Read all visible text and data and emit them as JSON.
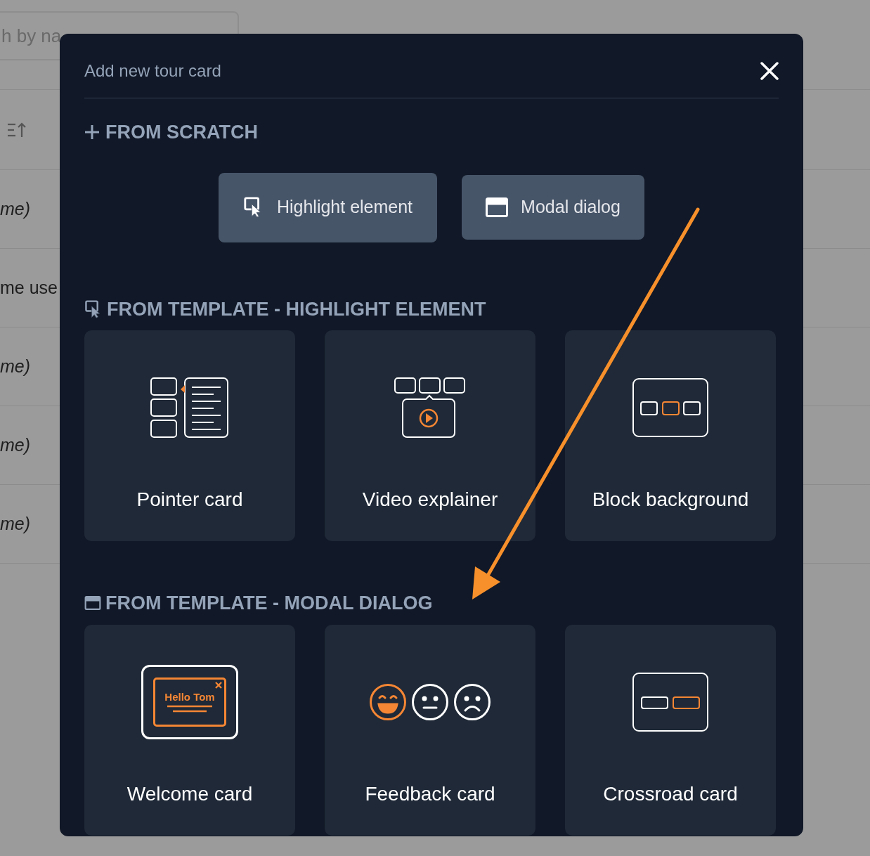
{
  "background": {
    "search": {
      "value": "h by na"
    },
    "rows": [
      {
        "text": "me)",
        "italic": true
      },
      {
        "text": "me use",
        "italic": false
      },
      {
        "text": "me)",
        "italic": true
      },
      {
        "text": "me)",
        "italic": true
      },
      {
        "text": "me)",
        "italic": true
      }
    ]
  },
  "modal": {
    "title": "Add new tour card",
    "scratch": {
      "heading": "FROM SCRATCH",
      "buttons": [
        {
          "label": "Highlight element",
          "kind": "highlight"
        },
        {
          "label": "Modal dialog",
          "kind": "modal"
        }
      ]
    },
    "sections": [
      {
        "heading": "FROM TEMPLATE - HIGHLIGHT ELEMENT",
        "kind": "highlight",
        "cards": [
          {
            "label": "Pointer card",
            "kind": "pointer"
          },
          {
            "label": "Video explainer",
            "kind": "video"
          },
          {
            "label": "Block background",
            "kind": "block"
          }
        ]
      },
      {
        "heading": "FROM TEMPLATE - MODAL DIALOG",
        "kind": "modal",
        "cards": [
          {
            "label": "Welcome card",
            "kind": "welcome",
            "illustration_text": "Hello Tom"
          },
          {
            "label": "Feedback card",
            "kind": "feedback"
          },
          {
            "label": "Crossroad card",
            "kind": "crossroad"
          }
        ]
      }
    ]
  }
}
